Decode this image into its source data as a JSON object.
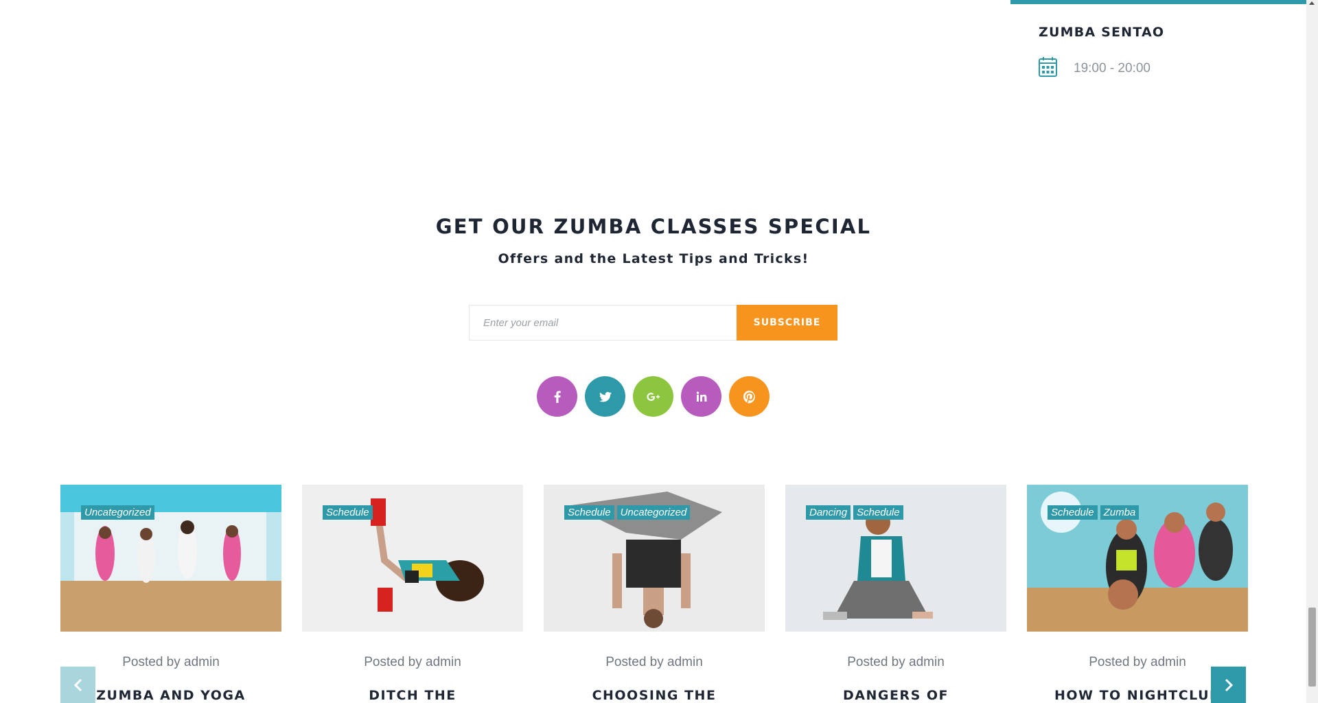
{
  "schedule": {
    "title": "ZUMBA SENTAO",
    "time": "19:00 - 20:00",
    "icon": "calendar-icon"
  },
  "newsletter": {
    "title": "GET OUR ZUMBA CLASSES SPECIAL",
    "subtitle": "Offers and the Latest Tips and Tricks!",
    "email_placeholder": "Enter your email",
    "subscribe_label": "SUBSCRIBE"
  },
  "social": [
    {
      "name": "facebook-icon",
      "color": "#b75bbd"
    },
    {
      "name": "twitter-icon",
      "color": "#2e9aa9"
    },
    {
      "name": "google-plus-icon",
      "color": "#8cc63f"
    },
    {
      "name": "linkedin-icon",
      "color": "#b75bbd"
    },
    {
      "name": "pinterest-icon",
      "color": "#f7941d"
    }
  ],
  "posts": [
    {
      "tags": [
        "Uncategorized"
      ],
      "meta": "Posted by admin",
      "title": "ZUMBA AND YOGA"
    },
    {
      "tags": [
        "Schedule"
      ],
      "meta": "Posted by admin",
      "title": "DITCH THE"
    },
    {
      "tags": [
        "Schedule",
        "Uncategorized"
      ],
      "meta": "Posted by admin",
      "title": "CHOOSING THE"
    },
    {
      "tags": [
        "Dancing",
        "Schedule"
      ],
      "meta": "Posted by admin",
      "title": "DANGERS OF"
    },
    {
      "tags": [
        "Schedule",
        "Zumba"
      ],
      "meta": "Posted by admin",
      "title": "HOW TO NIGHTCLUB"
    }
  ],
  "colors": {
    "accent": "#2e9aa9",
    "orange": "#f7941d",
    "purple": "#b75bbd",
    "green": "#8cc63f",
    "text_dark": "#1f2633"
  }
}
